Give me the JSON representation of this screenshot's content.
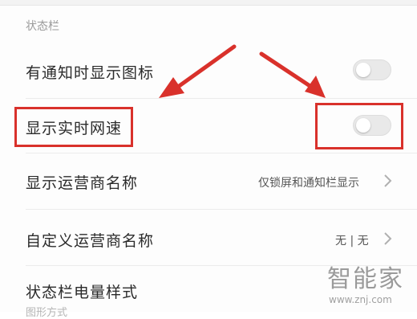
{
  "section": {
    "title": "状态栏"
  },
  "rows": [
    {
      "label": "有通知时显示图标",
      "control": "toggle",
      "on": false
    },
    {
      "label": "显示实时网速",
      "control": "toggle",
      "on": false
    },
    {
      "label": "显示运营商名称",
      "control": "chevron",
      "value": "仅锁屏和通知栏显示"
    },
    {
      "label": "自定义运营商名称",
      "control": "chevron",
      "value": "无 | 无"
    },
    {
      "label": "状态栏电量样式",
      "control": "none",
      "sub": "图形方式"
    }
  ],
  "watermark": {
    "title": "智能家",
    "url": "www.znj.com"
  },
  "colors": {
    "annotation": "#d9312b",
    "toggle_off": "#e9e9e9",
    "text": "#2b2b2b",
    "muted": "#9a9a9a"
  },
  "icons": [
    "chevron-right-icon",
    "annotation-arrow"
  ]
}
